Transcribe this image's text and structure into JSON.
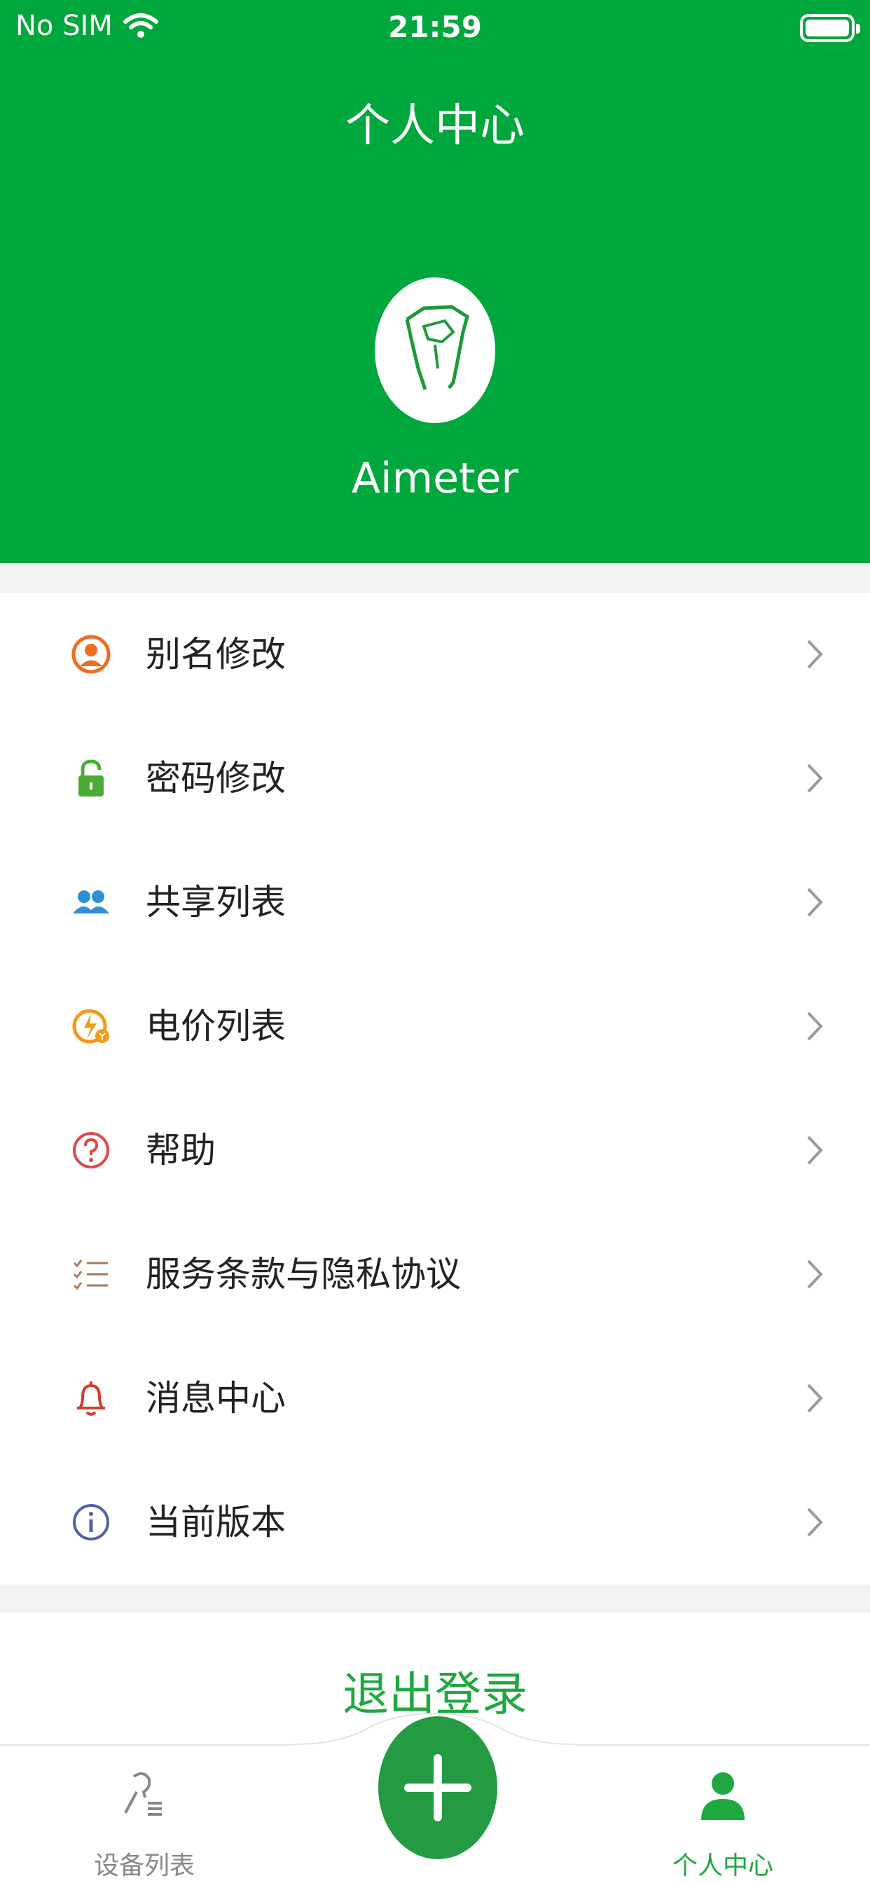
{
  "status_bar": {
    "carrier": "No SIM",
    "time": "21:59"
  },
  "header": {
    "title": "个人中心",
    "username": "Aimeter"
  },
  "menu": {
    "items": [
      {
        "label": "别名修改",
        "icon": "user-circle-icon",
        "color": "#f06c1e"
      },
      {
        "label": "密码修改",
        "icon": "lock-icon",
        "color": "#4cab34"
      },
      {
        "label": "共享列表",
        "icon": "users-icon",
        "color": "#2d8fd6"
      },
      {
        "label": "电价列表",
        "icon": "electricity-price-icon",
        "color": "#f39a1d"
      },
      {
        "label": "帮助",
        "icon": "help-icon",
        "color": "#e04848"
      },
      {
        "label": "服务条款与隐私协议",
        "icon": "checklist-icon",
        "color": "#a97a5a"
      },
      {
        "label": "消息中心",
        "icon": "bell-icon",
        "color": "#d23c2c"
      },
      {
        "label": "当前版本",
        "icon": "info-icon",
        "color": "#5560a8"
      }
    ]
  },
  "logout": {
    "label": "退出登录"
  },
  "tabbar": {
    "tabs": [
      {
        "label": "设备列表",
        "active": false
      },
      {
        "label": "个人中心",
        "active": true
      }
    ],
    "active_color": "#1fa83f",
    "inactive_color": "#888888"
  },
  "colors": {
    "brand": "#00a73c",
    "fab": "#249a43"
  }
}
